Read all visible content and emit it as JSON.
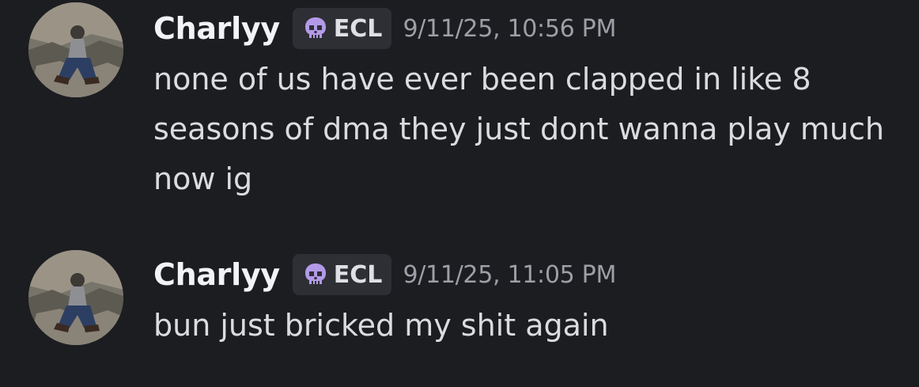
{
  "colors": {
    "background": "#1c1d21",
    "username": "#f2f3f5",
    "message_text": "#dbdcdf",
    "timestamp": "#9d9fa6",
    "tag_background": "#2e2f35",
    "tag_icon": "#b39ae8"
  },
  "messages": [
    {
      "author": "Charlyy",
      "avatar_icon": "user-avatar-photo",
      "tag": {
        "icon": "skull-icon",
        "label": "ECL"
      },
      "timestamp": "9/11/25, 10:56 PM",
      "lines": [
        "none of us have ever been clapped in like 8",
        "seasons of dma they just dont wanna play much",
        "now ig"
      ]
    },
    {
      "author": "Charlyy",
      "avatar_icon": "user-avatar-photo",
      "tag": {
        "icon": "skull-icon",
        "label": "ECL"
      },
      "timestamp": "9/11/25, 11:05 PM",
      "lines": [
        "bun just bricked my shit again"
      ]
    }
  ]
}
